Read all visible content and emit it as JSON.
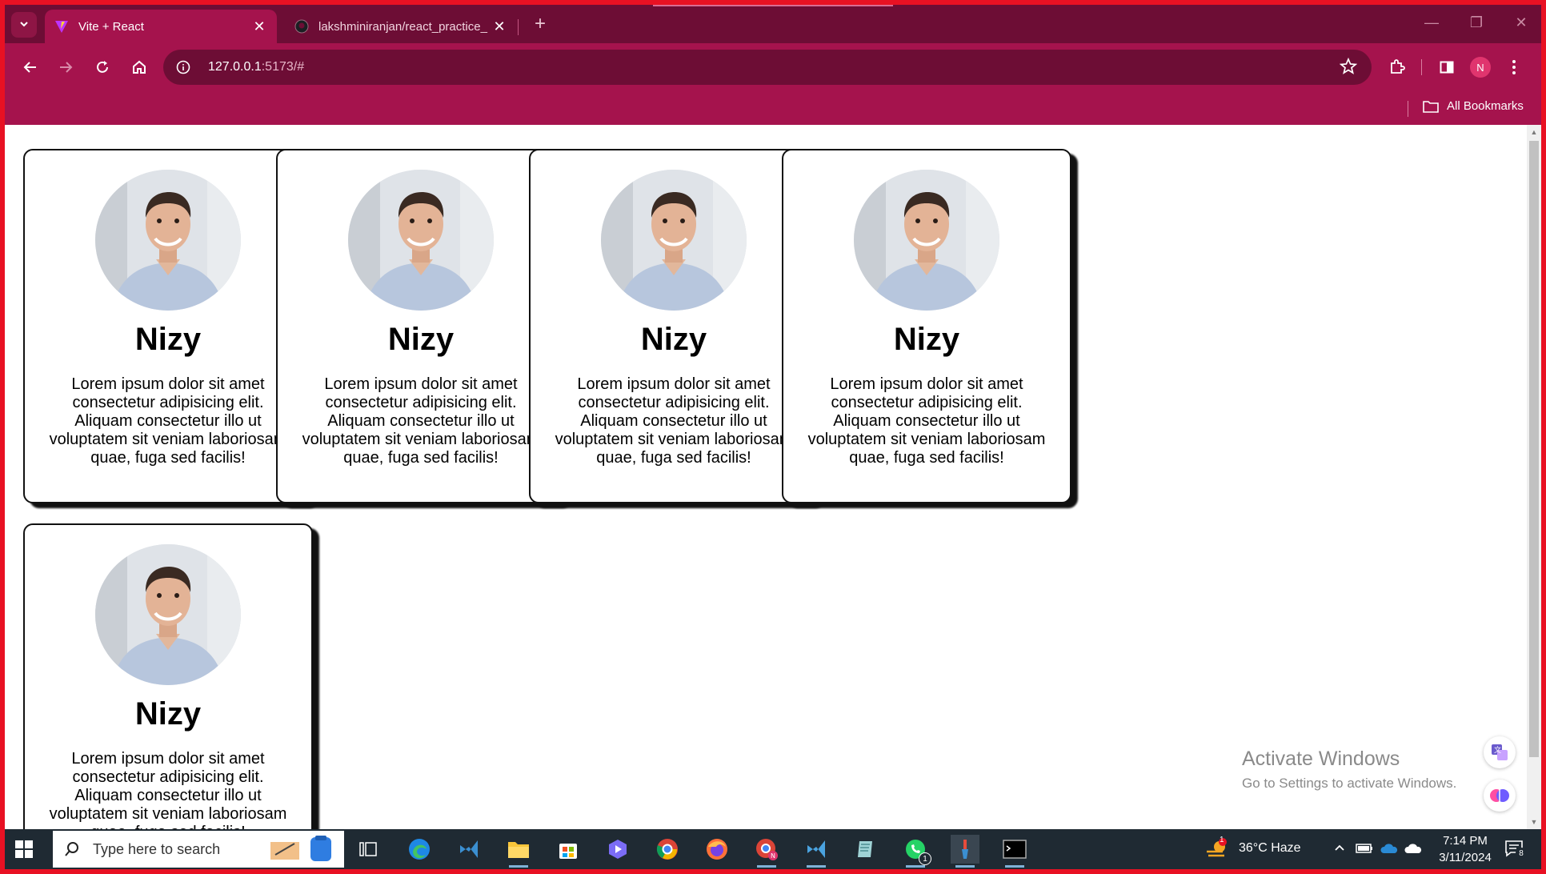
{
  "browser": {
    "tabs": [
      {
        "title": "Vite + React",
        "active": true
      },
      {
        "title": "lakshminiranjan/react_practice_",
        "active": false
      }
    ],
    "url_host": "127.0.0.1",
    "url_rest": ":5173/#",
    "profile_initial": "N",
    "bookmarks_label": "All Bookmarks"
  },
  "cards": [
    {
      "name": "Nizy",
      "description": "Lorem ipsum dolor sit amet consectetur adipisicing elit. Aliquam consectetur illo ut voluptatem sit veniam laboriosam quae, fuga sed facilis!"
    },
    {
      "name": "Nizy",
      "description": "Lorem ipsum dolor sit amet consectetur adipisicing elit. Aliquam consectetur illo ut voluptatem sit veniam laboriosam quae, fuga sed facilis!"
    },
    {
      "name": "Nizy",
      "description": "Lorem ipsum dolor sit amet consectetur adipisicing elit. Aliquam consectetur illo ut voluptatem sit veniam laboriosam quae, fuga sed facilis!"
    },
    {
      "name": "Nizy",
      "description": "Lorem ipsum dolor sit amet consectetur adipisicing elit. Aliquam consectetur illo ut voluptatem sit veniam laboriosam quae, fuga sed facilis!"
    },
    {
      "name": "Nizy",
      "description": "Lorem ipsum dolor sit amet consectetur adipisicing elit. Aliquam consectetur illo ut voluptatem sit veniam laboriosam quae, fuga sed facilis!"
    }
  ],
  "watermark": {
    "heading": "Activate Windows",
    "subtext": "Go to Settings to activate Windows."
  },
  "taskbar": {
    "search_placeholder": "Type here to search",
    "weather": "36°C  Haze",
    "weather_badge": "1",
    "time": "7:14 PM",
    "date": "3/11/2024",
    "notification_count": "8",
    "whatsapp_badge": "1"
  },
  "colors": {
    "chrome_dark": "#6d0d35",
    "chrome_main": "#a5134d",
    "screen_border": "#e81123"
  }
}
